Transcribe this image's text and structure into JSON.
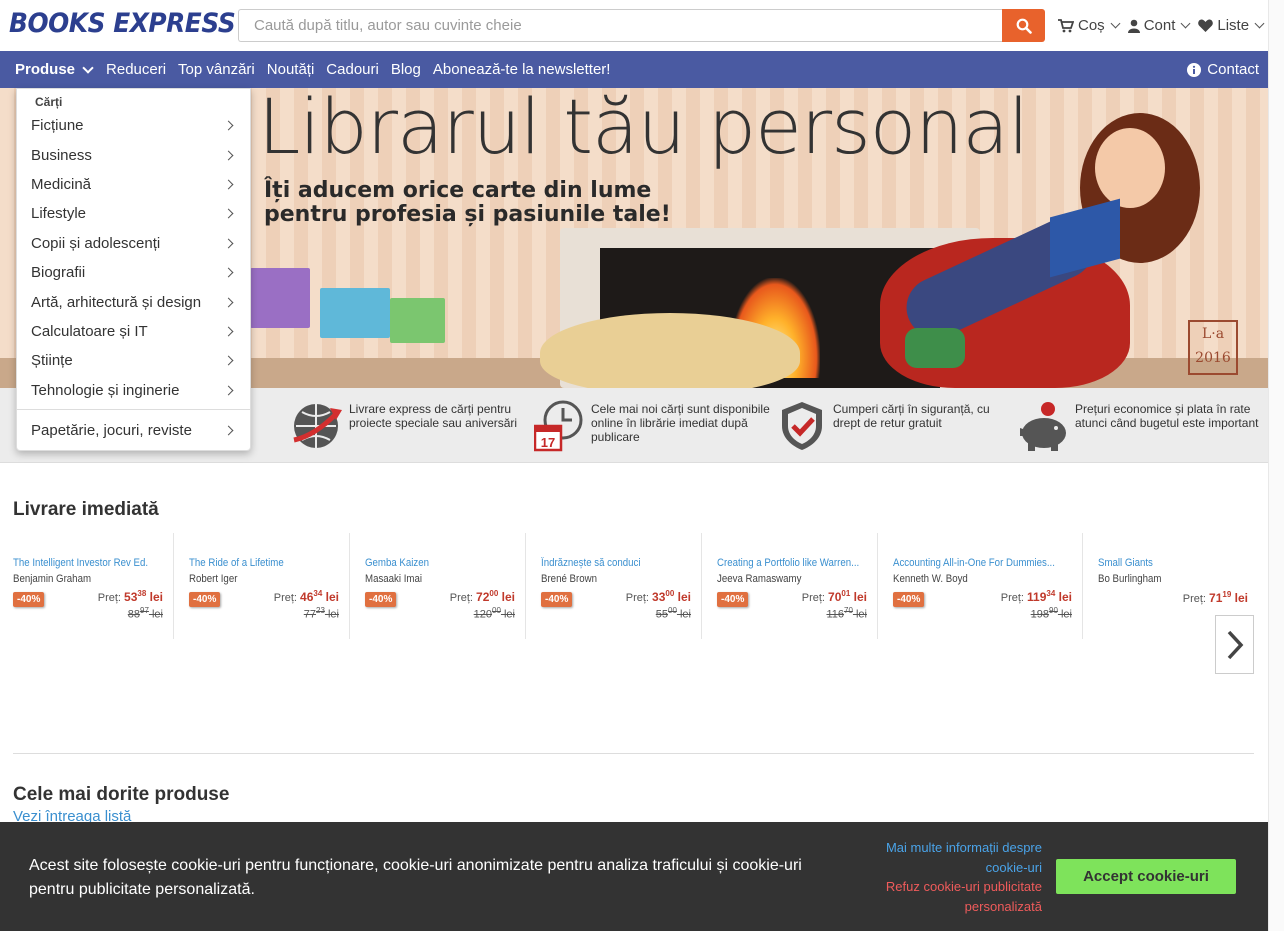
{
  "header": {
    "logo": "BOOKS EXPRESS",
    "search_placeholder": "Caută după titlu, autor sau cuvinte cheie",
    "cart_label": "Coș",
    "account_label": "Cont",
    "lists_label": "Liste"
  },
  "nav": {
    "products_label": "Produse",
    "items": [
      "Reduceri",
      "Top vânzări",
      "Noutăți",
      "Cadouri",
      "Blog",
      "Abonează-te la newsletter!"
    ],
    "contact_label": "Contact"
  },
  "dropdown": {
    "heading": "Cărți",
    "items": [
      "Ficțiune",
      "Business",
      "Medicină",
      "Lifestyle",
      "Copii și adolescenți",
      "Biografii",
      "Artă, arhitectură și design",
      "Calculatoare și IT",
      "Științe",
      "Tehnologie și inginerie"
    ],
    "last_item": "Papetărie, jocuri, reviste"
  },
  "hero": {
    "title": "Librarul tău personal",
    "subtitle_line1": "Îți aducem orice carte din lume",
    "subtitle_line2": "pentru profesia și pasiunile tale!",
    "signature": "L·a 2016"
  },
  "features": [
    {
      "text": "Livrare express de cărți pentru proiecte speciale sau aniversări",
      "icon": "globe-delivery-icon"
    },
    {
      "text": "Cele mai noi cărți sunt disponibile online în librărie imediat după publicare",
      "icon": "clock-calendar-icon",
      "calendar_day": "17"
    },
    {
      "text": "Cumperi cărți în siguranță, cu drept de retur gratuit",
      "icon": "shield-check-icon"
    },
    {
      "text": "Prețuri economice și plata în rate atunci când bugetul este important",
      "icon": "piggy-bank-icon"
    }
  ],
  "section_delivery": {
    "title": "Livrare imediată",
    "price_label": "Preț:",
    "currency": "lei",
    "products": [
      {
        "title": "The Intelligent Investor Rev Ed.",
        "author": "Benjamin Graham",
        "discount": "-40%",
        "price_int": "53",
        "price_dec": "38",
        "old_int": "88",
        "old_dec": "97"
      },
      {
        "title": "The Ride of a Lifetime",
        "author": "Robert Iger",
        "discount": "-40%",
        "price_int": "46",
        "price_dec": "34",
        "old_int": "77",
        "old_dec": "23"
      },
      {
        "title": "Gemba Kaizen",
        "author": "Masaaki Imai",
        "discount": "-40%",
        "price_int": "72",
        "price_dec": "00",
        "old_int": "120",
        "old_dec": "00"
      },
      {
        "title": "Îndrăznește să conduci",
        "author": "Brené Brown",
        "discount": "-40%",
        "price_int": "33",
        "price_dec": "00",
        "old_int": "55",
        "old_dec": "00"
      },
      {
        "title": "Creating a Portfolio like Warren...",
        "author": "Jeeva Ramaswamy",
        "discount": "-40%",
        "price_int": "70",
        "price_dec": "01",
        "old_int": "116",
        "old_dec": "70"
      },
      {
        "title": "Accounting All-in-One For Dummies...",
        "author": "Kenneth W. Boyd",
        "discount": "-40%",
        "price_int": "119",
        "price_dec": "34",
        "old_int": "198",
        "old_dec": "90"
      },
      {
        "title": "Small Giants",
        "author": "Bo Burlingham",
        "discount": "",
        "price_int": "71",
        "price_dec": "19",
        "old_int": "",
        "old_dec": ""
      }
    ]
  },
  "section_wanted": {
    "title": "Cele mai dorite produse",
    "see_all": "Vezi întreaga listă"
  },
  "cookie": {
    "text": "Acest site folosește cookie-uri pentru funcționare, cookie-uri anonimizate pentru analiza traficului și cookie-uri pentru publicitate personalizată.",
    "more_info": "Mai multe informații despre cookie-uri",
    "refuse": "Refuz cookie-uri publicitate personalizată",
    "accept": "Accept cookie-uri"
  },
  "colors": {
    "nav_bg": "#4a5aa2",
    "accent_orange": "#e8622c",
    "price_red": "#c0392b",
    "link_blue": "#3a8fcf",
    "accept_green": "#7ee35b"
  }
}
